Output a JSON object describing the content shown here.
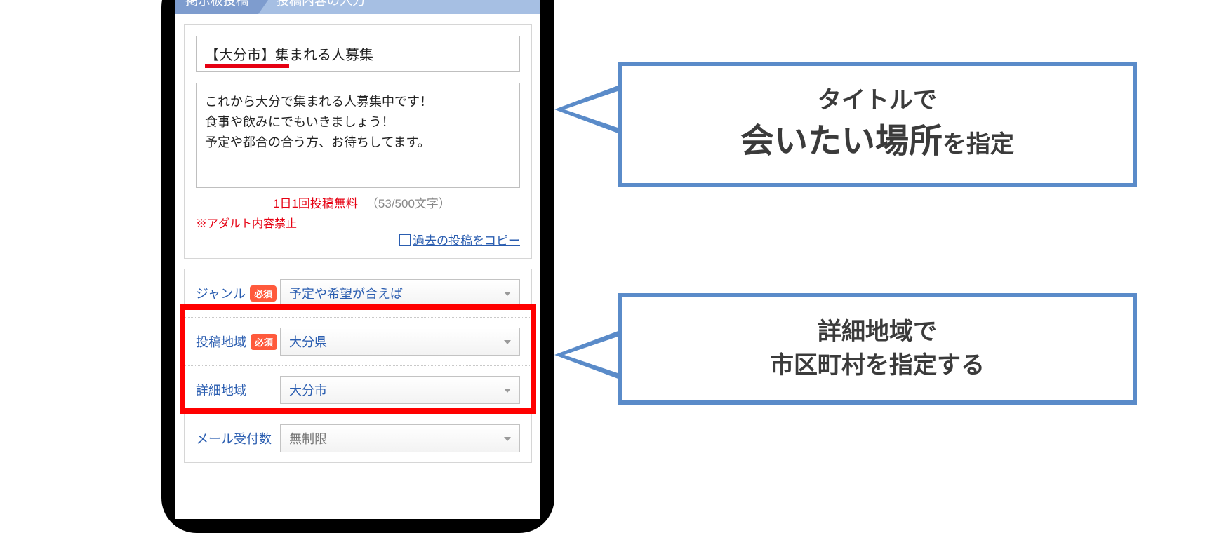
{
  "crumbs": {
    "step1": "掲示板投稿",
    "step2": "投稿内容の入力"
  },
  "post": {
    "title": "【大分市】集まれる人募集",
    "body": "これから大分で集まれる人募集中です！\n食事や飲みにでもいきましょう！\n予定や都合の合う方、お待ちしてます。",
    "free_label": "1日1回投稿無料",
    "char_count": "（53/500文字）",
    "adult_notice": "※アダルト内容禁止",
    "copy_past": "過去の投稿をコピー"
  },
  "form": {
    "genre": {
      "label": "ジャンル",
      "required": "必須",
      "value": "予定や希望が合えば"
    },
    "region": {
      "label": "投稿地域",
      "required": "必須",
      "value": "大分県"
    },
    "detail": {
      "label": "詳細地域",
      "value": "大分市"
    },
    "mail": {
      "label": "メール受付数",
      "value": "無制限"
    }
  },
  "callouts": {
    "c1_line1": "タイトルで",
    "c1_strong": "会いたい場所",
    "c1_tail": "を指定",
    "c2_line1": "詳細地域で",
    "c2_line2": "市区町村を指定する"
  }
}
